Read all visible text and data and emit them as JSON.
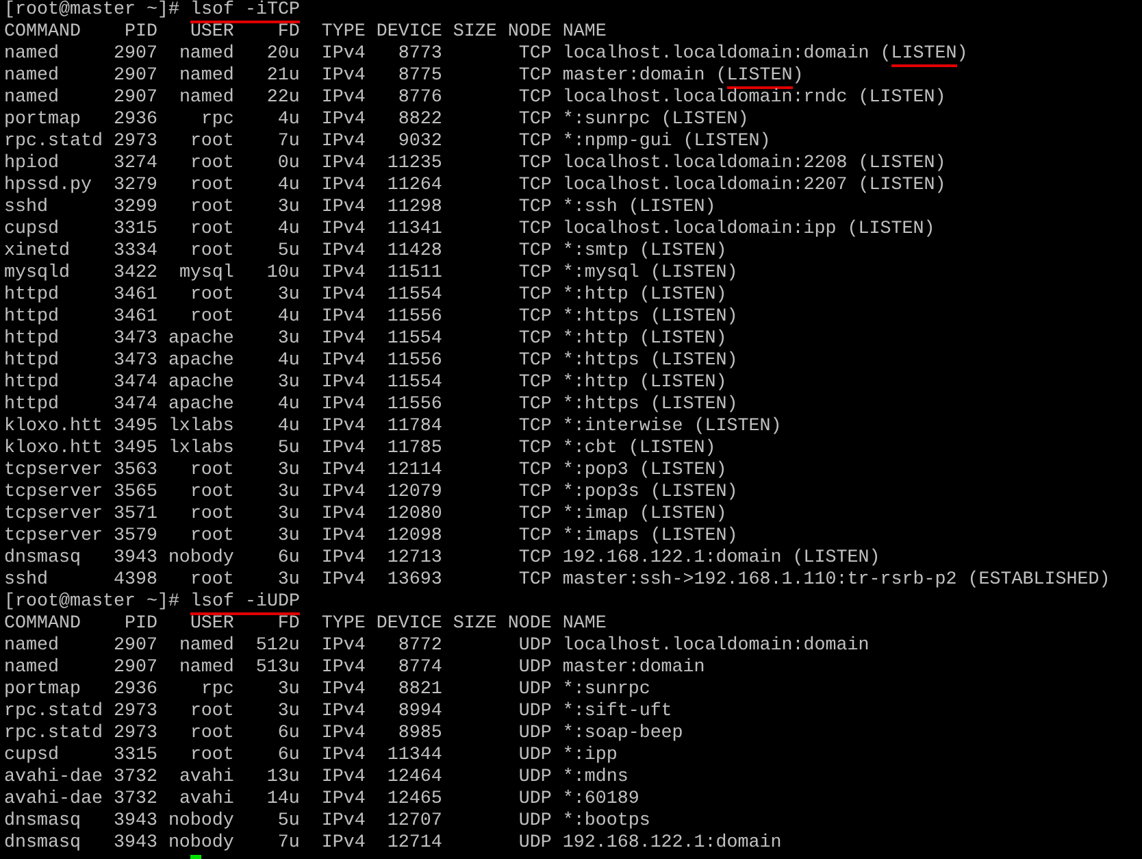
{
  "terminal": {
    "blocks": [
      {
        "prompt_line": "[root@master ~]# lsof -iTCP",
        "annotated": true,
        "columns": [
          "COMMAND",
          "PID",
          "USER",
          "FD",
          "TYPE",
          "DEVICE",
          "SIZE",
          "NODE",
          "NAME"
        ],
        "rows": [
          {
            "command": "named",
            "pid": "2907",
            "user": "named",
            "fd": "20u",
            "type": "IPv4",
            "device": "8773",
            "node": "TCP",
            "name": "localhost.localdomain:domain (LISTEN)",
            "annotated": true
          },
          {
            "command": "named",
            "pid": "2907",
            "user": "named",
            "fd": "21u",
            "type": "IPv4",
            "device": "8775",
            "node": "TCP",
            "name": "master:domain (LISTEN)",
            "annotated": true
          },
          {
            "command": "named",
            "pid": "2907",
            "user": "named",
            "fd": "22u",
            "type": "IPv4",
            "device": "8776",
            "node": "TCP",
            "name": "localhost.localdomain:rndc (LISTEN)",
            "annotated": false
          },
          {
            "command": "portmap",
            "pid": "2936",
            "user": "rpc",
            "fd": "4u",
            "type": "IPv4",
            "device": "8822",
            "node": "TCP",
            "name": "*:sunrpc (LISTEN)",
            "annotated": false
          },
          {
            "command": "rpc.statd",
            "pid": "2973",
            "user": "root",
            "fd": "7u",
            "type": "IPv4",
            "device": "9032",
            "node": "TCP",
            "name": "*:npmp-gui (LISTEN)",
            "annotated": false
          },
          {
            "command": "hpiod",
            "pid": "3274",
            "user": "root",
            "fd": "0u",
            "type": "IPv4",
            "device": "11235",
            "node": "TCP",
            "name": "localhost.localdomain:2208 (LISTEN)",
            "annotated": false
          },
          {
            "command": "hpssd.py",
            "pid": "3279",
            "user": "root",
            "fd": "4u",
            "type": "IPv4",
            "device": "11264",
            "node": "TCP",
            "name": "localhost.localdomain:2207 (LISTEN)",
            "annotated": false
          },
          {
            "command": "sshd",
            "pid": "3299",
            "user": "root",
            "fd": "3u",
            "type": "IPv4",
            "device": "11298",
            "node": "TCP",
            "name": "*:ssh (LISTEN)",
            "annotated": false
          },
          {
            "command": "cupsd",
            "pid": "3315",
            "user": "root",
            "fd": "4u",
            "type": "IPv4",
            "device": "11341",
            "node": "TCP",
            "name": "localhost.localdomain:ipp (LISTEN)",
            "annotated": false
          },
          {
            "command": "xinetd",
            "pid": "3334",
            "user": "root",
            "fd": "5u",
            "type": "IPv4",
            "device": "11428",
            "node": "TCP",
            "name": "*:smtp (LISTEN)",
            "annotated": false
          },
          {
            "command": "mysqld",
            "pid": "3422",
            "user": "mysql",
            "fd": "10u",
            "type": "IPv4",
            "device": "11511",
            "node": "TCP",
            "name": "*:mysql (LISTEN)",
            "annotated": false
          },
          {
            "command": "httpd",
            "pid": "3461",
            "user": "root",
            "fd": "3u",
            "type": "IPv4",
            "device": "11554",
            "node": "TCP",
            "name": "*:http (LISTEN)",
            "annotated": false
          },
          {
            "command": "httpd",
            "pid": "3461",
            "user": "root",
            "fd": "4u",
            "type": "IPv4",
            "device": "11556",
            "node": "TCP",
            "name": "*:https (LISTEN)",
            "annotated": false
          },
          {
            "command": "httpd",
            "pid": "3473",
            "user": "apache",
            "fd": "3u",
            "type": "IPv4",
            "device": "11554",
            "node": "TCP",
            "name": "*:http (LISTEN)",
            "annotated": false
          },
          {
            "command": "httpd",
            "pid": "3473",
            "user": "apache",
            "fd": "4u",
            "type": "IPv4",
            "device": "11556",
            "node": "TCP",
            "name": "*:https (LISTEN)",
            "annotated": false
          },
          {
            "command": "httpd",
            "pid": "3474",
            "user": "apache",
            "fd": "3u",
            "type": "IPv4",
            "device": "11554",
            "node": "TCP",
            "name": "*:http (LISTEN)",
            "annotated": false
          },
          {
            "command": "httpd",
            "pid": "3474",
            "user": "apache",
            "fd": "4u",
            "type": "IPv4",
            "device": "11556",
            "node": "TCP",
            "name": "*:https (LISTEN)",
            "annotated": false
          },
          {
            "command": "kloxo.htt",
            "pid": "3495",
            "user": "lxlabs",
            "fd": "4u",
            "type": "IPv4",
            "device": "11784",
            "node": "TCP",
            "name": "*:interwise (LISTEN)",
            "annotated": false
          },
          {
            "command": "kloxo.htt",
            "pid": "3495",
            "user": "lxlabs",
            "fd": "5u",
            "type": "IPv4",
            "device": "11785",
            "node": "TCP",
            "name": "*:cbt (LISTEN)",
            "annotated": false
          },
          {
            "command": "tcpserver",
            "pid": "3563",
            "user": "root",
            "fd": "3u",
            "type": "IPv4",
            "device": "12114",
            "node": "TCP",
            "name": "*:pop3 (LISTEN)",
            "annotated": false
          },
          {
            "command": "tcpserver",
            "pid": "3565",
            "user": "root",
            "fd": "3u",
            "type": "IPv4",
            "device": "12079",
            "node": "TCP",
            "name": "*:pop3s (LISTEN)",
            "annotated": false
          },
          {
            "command": "tcpserver",
            "pid": "3571",
            "user": "root",
            "fd": "3u",
            "type": "IPv4",
            "device": "12080",
            "node": "TCP",
            "name": "*:imap (LISTEN)",
            "annotated": false
          },
          {
            "command": "tcpserver",
            "pid": "3579",
            "user": "root",
            "fd": "3u",
            "type": "IPv4",
            "device": "12098",
            "node": "TCP",
            "name": "*:imaps (LISTEN)",
            "annotated": false
          },
          {
            "command": "dnsmasq",
            "pid": "3943",
            "user": "nobody",
            "fd": "6u",
            "type": "IPv4",
            "device": "12713",
            "node": "TCP",
            "name": "192.168.122.1:domain (LISTEN)",
            "annotated": false
          },
          {
            "command": "sshd",
            "pid": "4398",
            "user": "root",
            "fd": "3u",
            "type": "IPv4",
            "device": "13693",
            "node": "TCP",
            "name": "master:ssh->192.168.1.110:tr-rsrb-p2 (ESTABLISHED)",
            "annotated": false
          }
        ]
      },
      {
        "prompt_line": "[root@master ~]# lsof -iUDP",
        "annotated": true,
        "columns": [
          "COMMAND",
          "PID",
          "USER",
          "FD",
          "TYPE",
          "DEVICE",
          "SIZE",
          "NODE",
          "NAME"
        ],
        "rows": [
          {
            "command": "named",
            "pid": "2907",
            "user": "named",
            "fd": "512u",
            "type": "IPv4",
            "device": "8772",
            "node": "UDP",
            "name": "localhost.localdomain:domain",
            "annotated": false
          },
          {
            "command": "named",
            "pid": "2907",
            "user": "named",
            "fd": "513u",
            "type": "IPv4",
            "device": "8774",
            "node": "UDP",
            "name": "master:domain",
            "annotated": false
          },
          {
            "command": "portmap",
            "pid": "2936",
            "user": "rpc",
            "fd": "3u",
            "type": "IPv4",
            "device": "8821",
            "node": "UDP",
            "name": "*:sunrpc",
            "annotated": false
          },
          {
            "command": "rpc.statd",
            "pid": "2973",
            "user": "root",
            "fd": "3u",
            "type": "IPv4",
            "device": "8994",
            "node": "UDP",
            "name": "*:sift-uft",
            "annotated": false
          },
          {
            "command": "rpc.statd",
            "pid": "2973",
            "user": "root",
            "fd": "6u",
            "type": "IPv4",
            "device": "8985",
            "node": "UDP",
            "name": "*:soap-beep",
            "annotated": false
          },
          {
            "command": "cupsd",
            "pid": "3315",
            "user": "root",
            "fd": "6u",
            "type": "IPv4",
            "device": "11344",
            "node": "UDP",
            "name": "*:ipp",
            "annotated": false
          },
          {
            "command": "avahi-dae",
            "pid": "3732",
            "user": "avahi",
            "fd": "13u",
            "type": "IPv4",
            "device": "12464",
            "node": "UDP",
            "name": "*:mdns",
            "annotated": false
          },
          {
            "command": "avahi-dae",
            "pid": "3732",
            "user": "avahi",
            "fd": "14u",
            "type": "IPv4",
            "device": "12465",
            "node": "UDP",
            "name": "*:60189",
            "annotated": false
          },
          {
            "command": "dnsmasq",
            "pid": "3943",
            "user": "nobody",
            "fd": "5u",
            "type": "IPv4",
            "device": "12707",
            "node": "UDP",
            "name": "*:bootps",
            "annotated": false
          },
          {
            "command": "dnsmasq",
            "pid": "3943",
            "user": "nobody",
            "fd": "7u",
            "type": "IPv4",
            "device": "12714",
            "node": "UDP",
            "name": "192.168.122.1:domain",
            "annotated": false
          }
        ]
      }
    ],
    "cursor": {
      "visible": true
    }
  }
}
